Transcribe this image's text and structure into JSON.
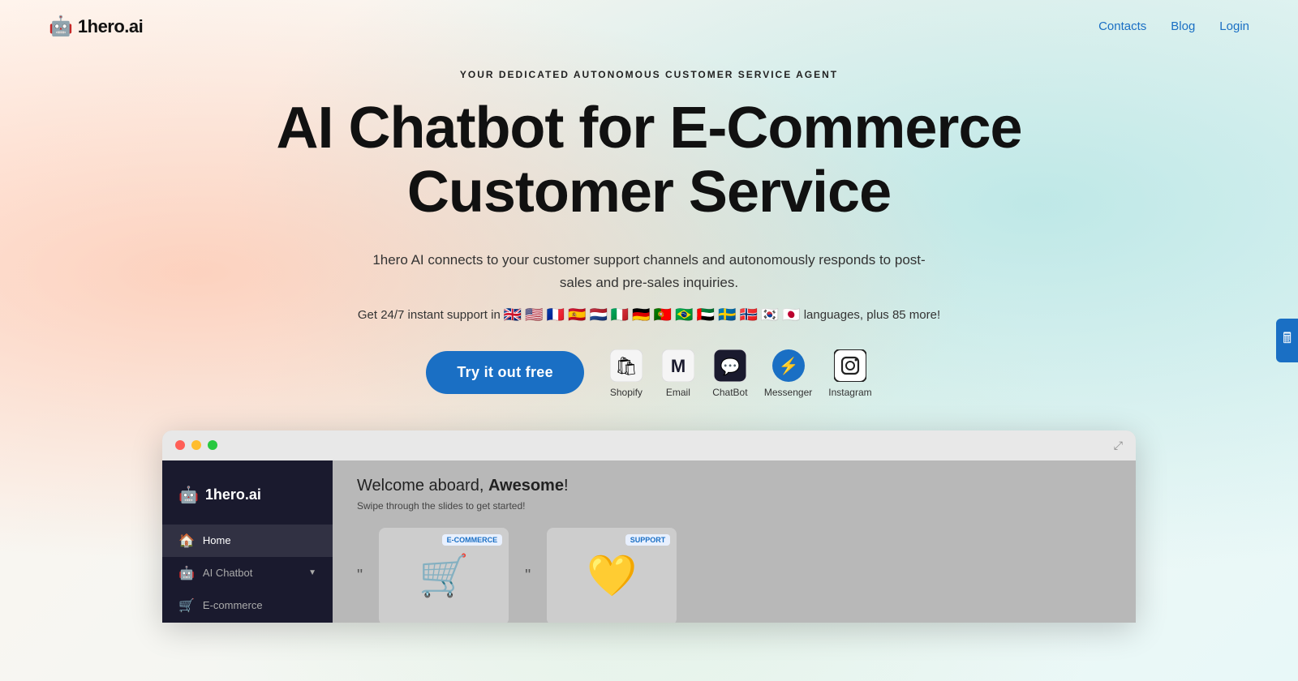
{
  "header": {
    "logo_text": "1hero.ai",
    "nav": {
      "contacts": "Contacts",
      "blog": "Blog",
      "login": "Login"
    }
  },
  "hero": {
    "subtitle": "YOUR DEDICATED AUTONOMOUS CUSTOMER SERVICE AGENT",
    "headline_line1": "AI Chatbot for E-Commerce",
    "headline_line2": "Customer Service",
    "description": "1hero AI connects to your customer support channels and autonomously responds to post-sales and pre-sales inquiries.",
    "languages_prefix": "Get 24/7 instant support in",
    "flags": [
      "🇬🇧",
      "🇺🇸",
      "🇫🇷",
      "🇪🇸",
      "🇳🇱",
      "🇮🇹",
      "🇩🇪",
      "🇵🇹",
      "🇧🇷",
      "🇦🇪",
      "🇸🇪",
      "🇳🇴",
      "🇰🇷",
      "🇯🇵"
    ],
    "languages_suffix": "languages, plus 85 more!",
    "cta_button": "Try it out free",
    "integrations": [
      {
        "label": "Shopify",
        "icon": "shopify"
      },
      {
        "label": "Email",
        "icon": "email"
      },
      {
        "label": "ChatBot",
        "icon": "chatbot"
      },
      {
        "label": "Messenger",
        "icon": "messenger"
      },
      {
        "label": "Instagram",
        "icon": "instagram"
      }
    ]
  },
  "app_preview": {
    "welcome_text": "Welcome aboard, ",
    "welcome_name": "Awesome",
    "welcome_exclaim": "!",
    "swipe_text": "Swipe through the slides to get started!",
    "sidebar_items": [
      {
        "label": "Home",
        "active": true
      },
      {
        "label": "AI Chatbot",
        "active": false
      },
      {
        "label": "E-commerce",
        "active": false
      }
    ],
    "slide1_badge": "E-COMMERCE",
    "slide2_badge": "SUPPORT"
  },
  "widget": {
    "icon": "🖩"
  }
}
